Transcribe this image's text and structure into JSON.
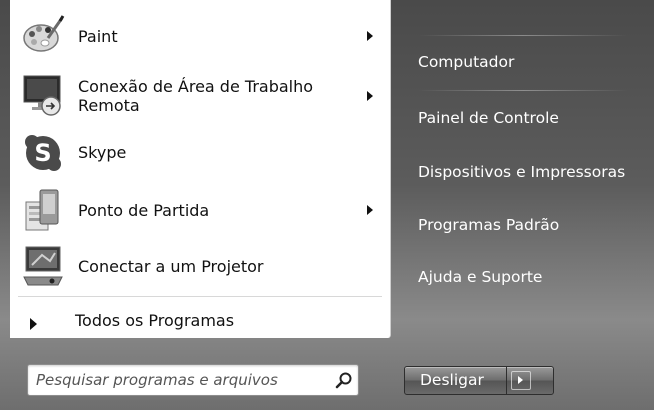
{
  "programs": [
    {
      "label": "Paint",
      "icon": "paint-palette-icon",
      "has_submenu": true
    },
    {
      "label_line1": "Conexão de Área de Trabalho",
      "label_line2": "Remota",
      "icon": "remote-desktop-icon",
      "has_submenu": true
    },
    {
      "label": "Skype",
      "icon": "skype-icon",
      "has_submenu": false
    },
    {
      "label": "Ponto de Partida",
      "icon": "getting-started-icon",
      "has_submenu": true
    },
    {
      "label": "Conectar a um Projetor",
      "icon": "projector-icon",
      "has_submenu": false
    }
  ],
  "all_programs_label": "Todos os Programas",
  "search": {
    "placeholder": "Pesquisar programas e arquivos",
    "icon": "search-icon"
  },
  "right_panel": {
    "items": [
      "Computador",
      "Painel de Controle",
      "Dispositivos e Impressoras",
      "Programas Padrão",
      "Ajuda e Suporte"
    ]
  },
  "shutdown": {
    "label": "Desligar",
    "arrow_icon": "chevron-right-icon"
  },
  "colors": {
    "left_panel": "#ffffff",
    "right_panel": "#5a5a5a",
    "text_dark": "#111111",
    "text_light": "#ffffff"
  }
}
